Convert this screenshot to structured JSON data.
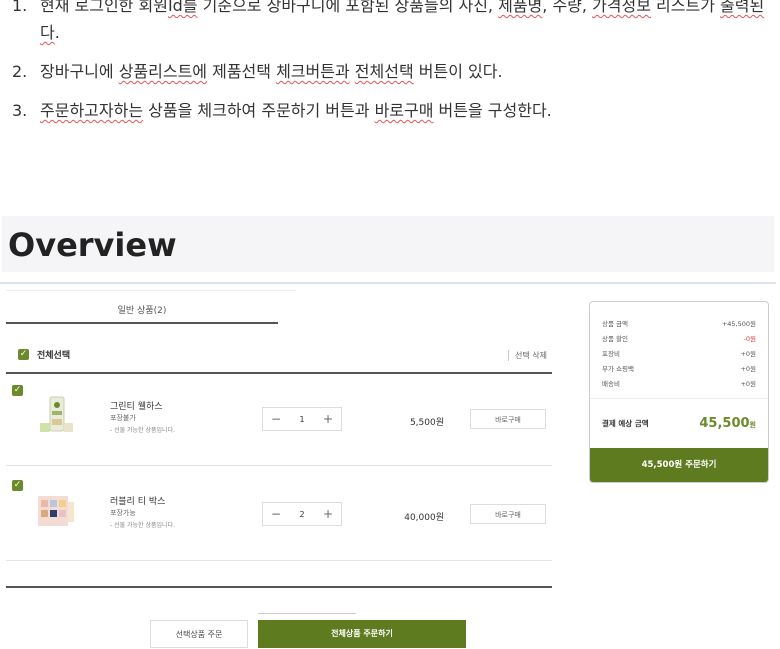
{
  "doc": {
    "items": [
      {
        "num": "1.",
        "parts": [
          {
            "t": "현재 로그인한 회원",
            "sq": false
          },
          {
            "t": "Id를",
            "sq": true
          },
          {
            "t": " 기준으로 장바구니에 포함된 상품들의 사진, ",
            "sq": false
          },
          {
            "t": "제품명",
            "sq": true
          },
          {
            "t": ", 수량, ",
            "sq": false
          },
          {
            "t": "가격정보",
            "sq": true
          },
          {
            "t": " 리스트가 ",
            "sq": false
          },
          {
            "t": "출력된다",
            "sq": true
          },
          {
            "t": ".",
            "sq": false
          }
        ]
      },
      {
        "num": "2.",
        "parts": [
          {
            "t": "장바구니에 ",
            "sq": false
          },
          {
            "t": "상품리스트에",
            "sq": true
          },
          {
            "t": " 제품선택 ",
            "sq": false
          },
          {
            "t": "체크버튼과",
            "sq": true
          },
          {
            "t": " ",
            "sq": false
          },
          {
            "t": "전체선택",
            "sq": true
          },
          {
            "t": " 버튼이 있다.",
            "sq": false
          }
        ]
      },
      {
        "num": "3.",
        "parts": [
          {
            "t": "주문하고자하는",
            "sq": true
          },
          {
            "t": " 상품을 체크하여 주문하기 버튼과 ",
            "sq": false
          },
          {
            "t": "바로구매",
            "sq": true
          },
          {
            "t": " 버튼을 구성한다.",
            "sq": false
          }
        ]
      }
    ],
    "overview_title": "Overview"
  },
  "cart": {
    "tab_label": "일반 상품(2)",
    "select_all_label": "전체선택",
    "delete_selected_label": "선택 삭제",
    "items": [
      {
        "name": "그린티 웰하스",
        "pack": "포장불가",
        "note": "- 선물 가능한 상품입니다.",
        "qty": "1",
        "price": "5,500원",
        "buy_now": "바로구매",
        "checked": true
      },
      {
        "name": "러블리 티 박스",
        "pack": "포장가능",
        "note": "- 선물 가능한 상품입니다.",
        "qty": "2",
        "price": "40,000원",
        "buy_now": "바로구매",
        "checked": true
      }
    ],
    "order_selected_label": "선택상품 주문",
    "order_all_label": "전체상품 주문하기"
  },
  "summary": {
    "rows": [
      {
        "label": "상품 금액",
        "value": "+45,500원",
        "red": false
      },
      {
        "label": "상품 할인",
        "value": "-0원",
        "red": true
      },
      {
        "label": "포장비",
        "value": "+0원",
        "red": false
      },
      {
        "label": "부가 쇼핑백",
        "value": "+0원",
        "red": false
      },
      {
        "label": "배송비",
        "value": "+0원",
        "red": false
      }
    ],
    "total_label": "결제 예상 금액",
    "total_value": "45,500",
    "total_unit": "원",
    "order_button": "45,500원 주문하기"
  },
  "colors": {
    "accent": "#5e7c1f",
    "check": "#6b8a2c",
    "discount": "#dd3333"
  }
}
